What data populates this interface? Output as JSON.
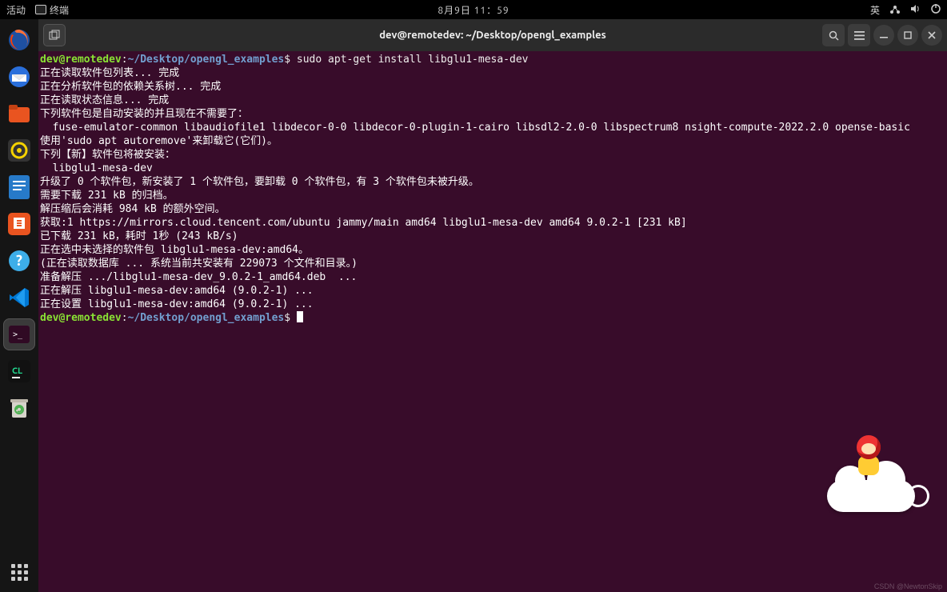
{
  "top": {
    "activities": "活动",
    "app_name": "终端",
    "datetime": "8月9日 11：59",
    "input_lang": "英"
  },
  "window": {
    "title": "dev@remotedev: ~/Desktop/opengl_examples"
  },
  "prompt": {
    "user_host": "dev@remotedev",
    "sep": ":",
    "cwd": "~/Desktop/opengl_examples",
    "dollar": "$"
  },
  "command": " sudo apt-get install libglu1-mesa-dev",
  "output_lines": [
    "正在读取软件包列表... 完成",
    "正在分析软件包的依赖关系树... 完成",
    "正在读取状态信息... 完成",
    "下列软件包是自动安装的并且现在不需要了：",
    "  fuse-emulator-common libaudiofile1 libdecor-0-0 libdecor-0-plugin-1-cairo libsdl2-2.0-0 libspectrum8 nsight-compute-2022.2.0 opense-basic",
    "使用'sudo apt autoremove'来卸载它(它们)。",
    "下列【新】软件包将被安装：",
    "  libglu1-mesa-dev",
    "升级了 0 个软件包，新安装了 1 个软件包，要卸载 0 个软件包，有 3 个软件包未被升级。",
    "需要下载 231 kB 的归档。",
    "解压缩后会消耗 984 kB 的额外空间。",
    "获取:1 https://mirrors.cloud.tencent.com/ubuntu jammy/main amd64 libglu1-mesa-dev amd64 9.0.2-1 [231 kB]",
    "已下载 231 kB，耗时 1秒 (243 kB/s)",
    "正在选中未选择的软件包 libglu1-mesa-dev:amd64。",
    "(正在读取数据库 ... 系统当前共安装有 229073 个文件和目录。)",
    "准备解压 .../libglu1-mesa-dev_9.0.2-1_amd64.deb  ...",
    "正在解压 libglu1-mesa-dev:amd64 (9.0.2-1) ...",
    "正在设置 libglu1-mesa-dev:amd64 (9.0.2-1) ..."
  ],
  "watermark": "CSDN @NewtonSkip"
}
